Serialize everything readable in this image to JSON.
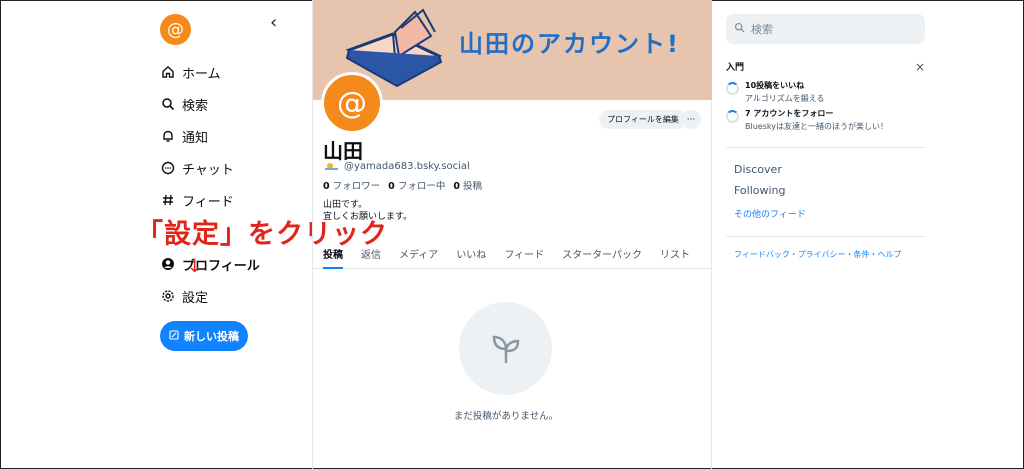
{
  "sidebar": {
    "logo_glyph": "@",
    "collapse_glyph": "‹",
    "items": [
      {
        "label": "ホーム",
        "icon": "home-icon"
      },
      {
        "label": "検索",
        "icon": "search-icon"
      },
      {
        "label": "通知",
        "icon": "bell-icon"
      },
      {
        "label": "チャット",
        "icon": "chat-icon"
      },
      {
        "label": "フィード",
        "icon": "hash-icon"
      },
      {
        "label": "プロフィール",
        "icon": "user-icon"
      },
      {
        "label": "設定",
        "icon": "gear-icon"
      }
    ],
    "new_post_label": "新しい投稿"
  },
  "annotation": {
    "text": "「設定」をクリック",
    "arrow": "↓",
    "color": "#e1251b"
  },
  "profile": {
    "banner_title": "山田のアカウント!",
    "avatar_glyph": "@",
    "edit_label": "プロフィールを編集",
    "more_label": "···",
    "name": "山田",
    "handle": "@yamada683.bsky.social",
    "stats": {
      "followers_count": "0",
      "followers_label": "フォロワー",
      "following_count": "0",
      "following_label": "フォロー中",
      "posts_count": "0",
      "posts_label": "投稿"
    },
    "bio_line1": "山田です。",
    "bio_line2": "宜しくお願いします。",
    "tabs": [
      "投稿",
      "返信",
      "メディア",
      "いいね",
      "フィード",
      "スターターパック",
      "リスト"
    ],
    "empty_text": "まだ投稿がありません。"
  },
  "right": {
    "search_placeholder": "検索",
    "intro_title": "入門",
    "close_glyph": "×",
    "tasks": [
      {
        "title": "10投稿をいいね",
        "sub": "アルゴリズムを鍛える"
      },
      {
        "title": "7 アカウントをフォロー",
        "sub": "Blueskyは友達と一緒のほうが楽しい！"
      }
    ],
    "feeds": [
      "Discover",
      "Following"
    ],
    "more_feeds": "その他のフィード",
    "footer": "フィードバック・プライバシー・条件・ヘルプ"
  },
  "colors": {
    "accent": "#1083fe",
    "brand": "#f5891b",
    "banner": "#e6c4ae"
  }
}
